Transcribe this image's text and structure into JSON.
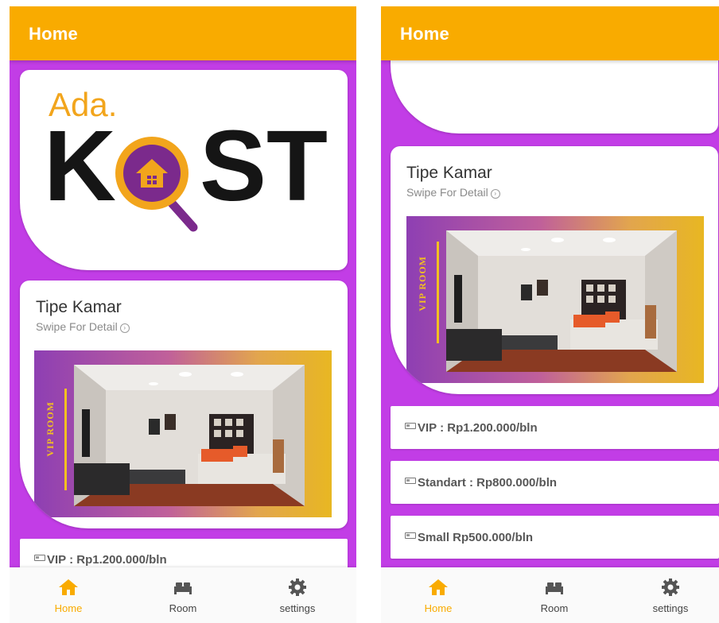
{
  "left": {
    "appbar": {
      "title": "Home"
    },
    "logo": {
      "ada": "Ada.",
      "k": "K",
      "st": "ST"
    },
    "room_card": {
      "title": "Tipe Kamar",
      "subtitle": "Swipe For Detail",
      "banner_label": "VIP ROOM"
    },
    "prices": [
      "VIP : Rp1.200.000/bln"
    ]
  },
  "right": {
    "appbar": {
      "title": "Home"
    },
    "room_card": {
      "title": "Tipe Kamar",
      "subtitle": "Swipe For Detail",
      "banner_label": "VIP ROOM"
    },
    "prices": [
      "VIP : Rp1.200.000/bln",
      "Standart : Rp800.000/bln",
      "Small Rp500.000/bln"
    ]
  },
  "nav": [
    {
      "label": "Home",
      "icon": "home-icon",
      "active": true
    },
    {
      "label": "Room",
      "icon": "bed-icon",
      "active": false
    },
    {
      "label": "settings",
      "icon": "gear-icon",
      "active": false
    }
  ],
  "colors": {
    "appbar": "#f9ab00",
    "background": "#c23de6",
    "accent": "#f9ab00",
    "logo_ring": "#f2a51c",
    "logo_center": "#7b2a8c"
  }
}
